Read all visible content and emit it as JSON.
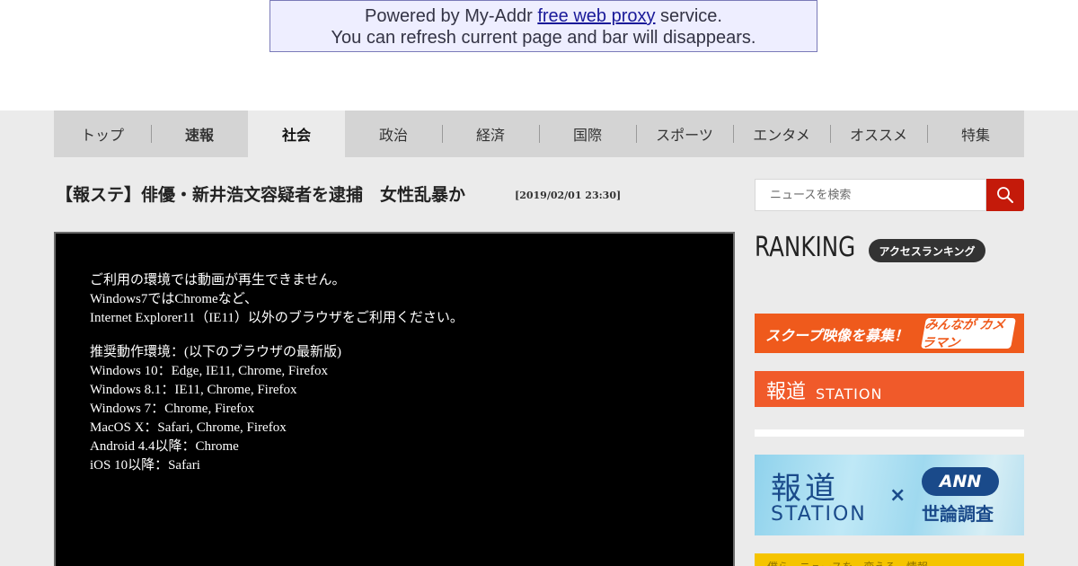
{
  "proxy_bar": {
    "line1_prefix": "Powered by My-Addr ",
    "line1_link": "free web proxy",
    "line1_suffix": " service.",
    "line2": "You can refresh current page and bar will disappears."
  },
  "nav": {
    "items": [
      {
        "label": "トップ"
      },
      {
        "label": "速報"
      },
      {
        "label": "社会"
      },
      {
        "label": "政治"
      },
      {
        "label": "経済"
      },
      {
        "label": "国際"
      },
      {
        "label": "スポーツ"
      },
      {
        "label": "エンタメ"
      },
      {
        "label": "オススメ"
      },
      {
        "label": "特集"
      }
    ],
    "active": "社会"
  },
  "article": {
    "title": "【報ステ】俳優・新井浩文容疑者を逮捕　女性乱暴か",
    "timestamp": "[2019/02/01 23:30]"
  },
  "video": {
    "message_lines": [
      "ご利用の環境では動画が再生できません。",
      "Windows7ではChromeなど、",
      "Internet Explorer11（IE11）以外のブラウザをご利用ください。"
    ],
    "env_lines": [
      "推奨動作環境：(以下のブラウザの最新版)",
      "Windows 10：Edge, IE11, Chrome, Firefox",
      "Windows 8.1：IE11, Chrome, Firefox",
      "Windows 7：Chrome, Firefox",
      "MacOS X：Safari, Chrome, Firefox",
      "Android 4.4以降：Chrome",
      "iOS 10以降：Safari"
    ]
  },
  "search": {
    "placeholder": "ニュースを検索"
  },
  "ranking": {
    "title": "RANKING",
    "subtitle": "アクセスランキング"
  },
  "banners": {
    "scoop_text": "スクープ映像を募集！",
    "scoop_logo": "みんなが カメラマン",
    "hodo_kanji": "報道",
    "hodo_latin": "STATION",
    "ann_kanji": "報道",
    "ann_latin": "STATION",
    "ann_times": "×",
    "ann_logo": "ANN",
    "ann_poll": "世論調査",
    "yellow_text": "僕ら　ニュースを　変える　情報"
  },
  "colors": {
    "search_button": "#c41a0a",
    "banner_orange": "#ef5a1c",
    "ann_blue": "#1a4a8a"
  },
  "icons": {
    "search_button": "magnifier-icon"
  }
}
